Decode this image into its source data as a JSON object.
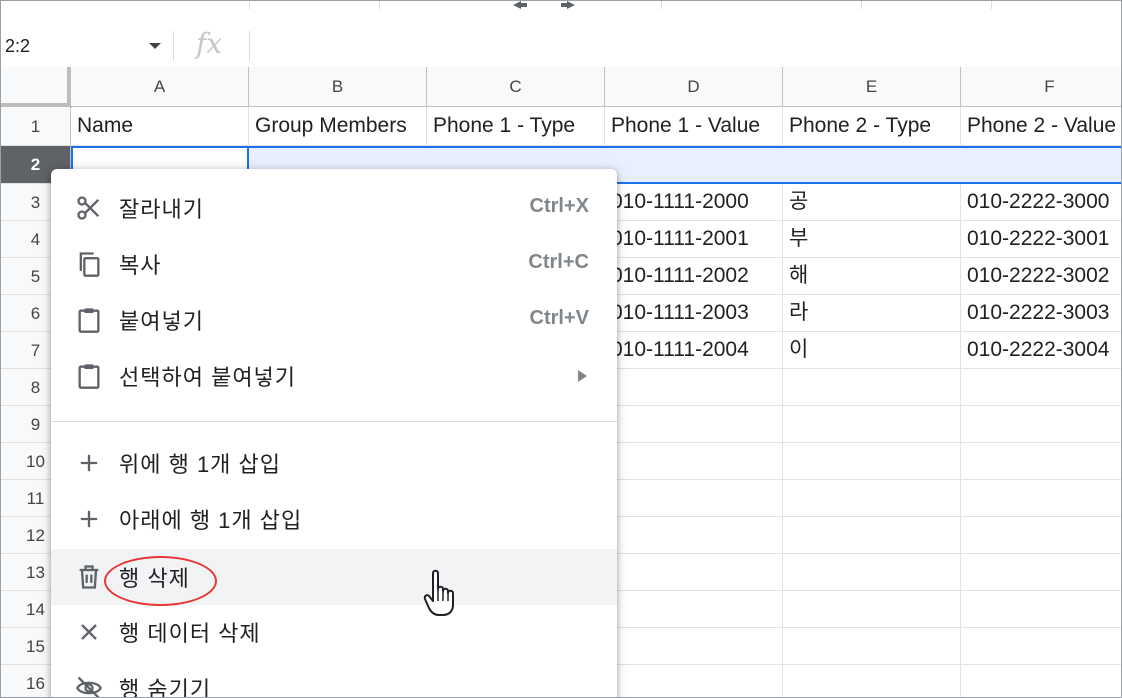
{
  "formula_bar": {
    "name_box": "2:2",
    "fx_label": "fx"
  },
  "columns": [
    "A",
    "B",
    "C",
    "D",
    "E",
    "F"
  ],
  "rows": [
    "1",
    "2",
    "3",
    "4",
    "5",
    "6",
    "7",
    "8",
    "9",
    "10",
    "11",
    "12",
    "13",
    "14",
    "15",
    "16"
  ],
  "selected_row": "2",
  "header_row": [
    "Name",
    "Group Members",
    "Phone 1 - Type",
    "Phone 1 - Value",
    "Phone 2 - Type",
    "Phone 2 - Value"
  ],
  "data_rows": [
    {
      "d": "010-1111-2000",
      "e": "공",
      "f": "010-2222-3000"
    },
    {
      "d": "010-1111-2001",
      "e": "부",
      "f": "010-2222-3001"
    },
    {
      "d": "010-1111-2002",
      "e": "해",
      "f": "010-2222-3002"
    },
    {
      "d": "010-1111-2003",
      "e": "라",
      "f": "010-2222-3003"
    },
    {
      "d": "010-1111-2004",
      "e": "이",
      "f": "010-2222-3004"
    }
  ],
  "context_menu": {
    "cut": {
      "label": "잘라내기",
      "shortcut": "Ctrl+X",
      "icon": "scissors-icon"
    },
    "copy": {
      "label": "복사",
      "shortcut": "Ctrl+C",
      "icon": "copy-icon"
    },
    "paste": {
      "label": "붙여넣기",
      "shortcut": "Ctrl+V",
      "icon": "clipboard-icon"
    },
    "paste_special": {
      "label": "선택하여 붙여넣기",
      "icon": "clipboard-icon"
    },
    "insert_above": {
      "label": "위에 행 1개 삽입",
      "icon": "plus-icon"
    },
    "insert_below": {
      "label": "아래에 행 1개 삽입",
      "icon": "plus-icon"
    },
    "delete_row": {
      "label": "행 삭제",
      "icon": "trash-icon"
    },
    "clear_row": {
      "label": "행 데이터 삭제",
      "icon": "close-icon"
    },
    "hide_row": {
      "label": "행 숨기기",
      "icon": "eye-off-icon"
    }
  },
  "colors": {
    "selection": "#1a73e8",
    "selected_row_bg": "#e8f0fe",
    "highlight": "#e53935"
  }
}
